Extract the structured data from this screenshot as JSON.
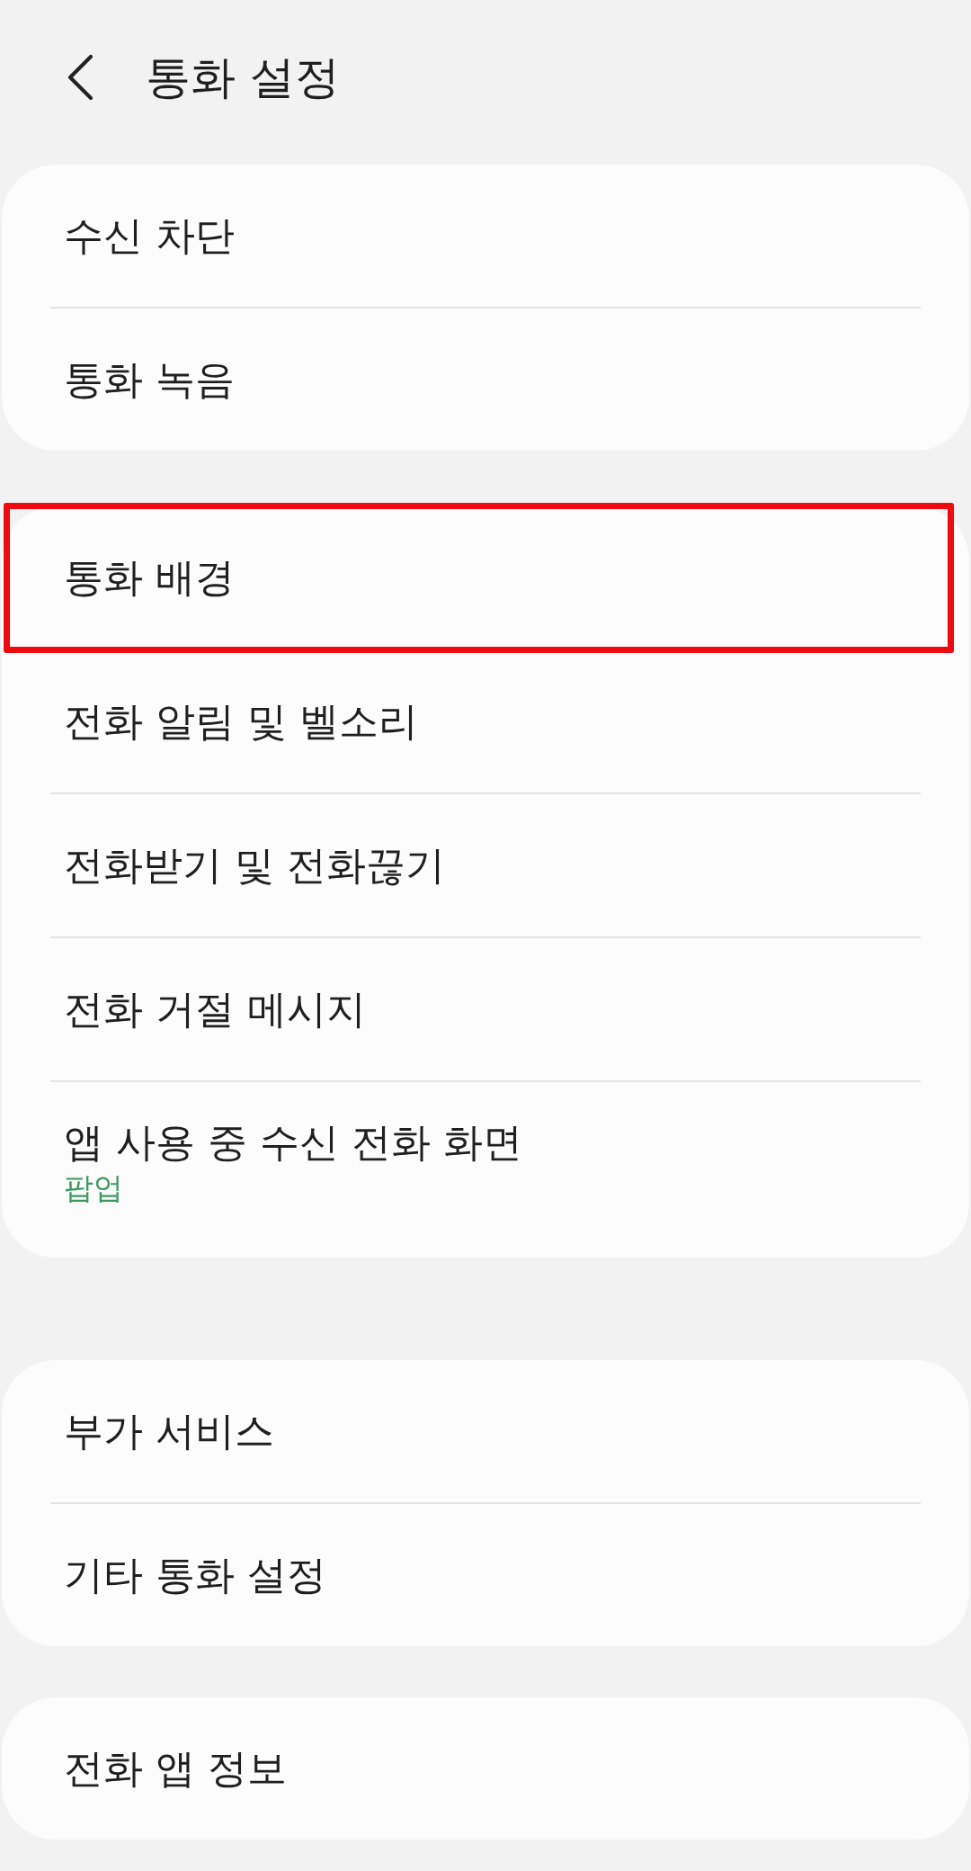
{
  "header": {
    "title": "통화 설정"
  },
  "groups": [
    {
      "items": [
        {
          "label": "수신 차단",
          "highlighted": false
        },
        {
          "label": "통화 녹음",
          "highlighted": false
        }
      ]
    },
    {
      "items": [
        {
          "label": "통화 배경",
          "highlighted": true
        },
        {
          "label": "전화 알림 및 벨소리",
          "highlighted": false
        },
        {
          "label": "전화받기 및 전화끊기",
          "highlighted": false
        },
        {
          "label": "전화 거절 메시지",
          "highlighted": false
        },
        {
          "label": "앱 사용 중 수신 전화 화면",
          "summary": "팝업",
          "highlighted": false
        }
      ]
    },
    {
      "items": [
        {
          "label": "부가 서비스",
          "highlighted": false
        },
        {
          "label": "기타 통화 설정",
          "highlighted": false
        }
      ]
    },
    {
      "items": [
        {
          "label": "전화 앱 정보",
          "highlighted": false
        }
      ]
    }
  ]
}
